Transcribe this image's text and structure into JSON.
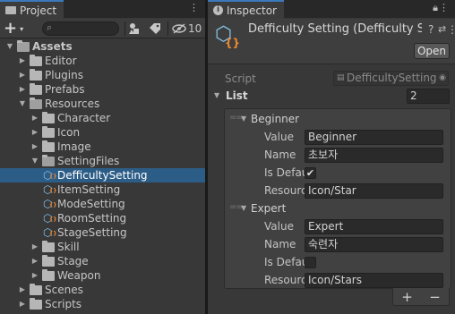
{
  "project": {
    "tab_label": "Project",
    "tab_menu": "⋮",
    "toolbar": {
      "add_label": "+",
      "add_caret": "▾",
      "hidden_count": "10"
    },
    "tree": [
      {
        "label": "Assets",
        "depth": 0,
        "arrow": "▼",
        "icon": "folder-open",
        "bold": true
      },
      {
        "label": "Editor",
        "depth": 1,
        "arrow": "▶",
        "icon": "folder"
      },
      {
        "label": "Plugins",
        "depth": 1,
        "arrow": "▶",
        "icon": "folder"
      },
      {
        "label": "Prefabs",
        "depth": 1,
        "arrow": "▶",
        "icon": "folder"
      },
      {
        "label": "Resources",
        "depth": 1,
        "arrow": "▼",
        "icon": "folder-open"
      },
      {
        "label": "Character",
        "depth": 2,
        "arrow": "▶",
        "icon": "folder"
      },
      {
        "label": "Icon",
        "depth": 2,
        "arrow": "▶",
        "icon": "folder"
      },
      {
        "label": "Image",
        "depth": 2,
        "arrow": "▶",
        "icon": "folder"
      },
      {
        "label": "SettingFiles",
        "depth": 2,
        "arrow": "▼",
        "icon": "folder-open"
      },
      {
        "label": "DefficultySetting",
        "depth": 3,
        "arrow": "",
        "icon": "so",
        "selected": true
      },
      {
        "label": "ItemSetting",
        "depth": 3,
        "arrow": "",
        "icon": "so"
      },
      {
        "label": "ModeSetting",
        "depth": 3,
        "arrow": "",
        "icon": "so"
      },
      {
        "label": "RoomSetting",
        "depth": 3,
        "arrow": "",
        "icon": "so"
      },
      {
        "label": "StageSetting",
        "depth": 3,
        "arrow": "",
        "icon": "so"
      },
      {
        "label": "Skill",
        "depth": 2,
        "arrow": "▶",
        "icon": "folder"
      },
      {
        "label": "Stage",
        "depth": 2,
        "arrow": "▶",
        "icon": "folder"
      },
      {
        "label": "Weapon",
        "depth": 2,
        "arrow": "▶",
        "icon": "folder"
      },
      {
        "label": "Scenes",
        "depth": 1,
        "arrow": "▶",
        "icon": "folder"
      },
      {
        "label": "Scripts",
        "depth": 1,
        "arrow": "▶",
        "icon": "folder"
      }
    ]
  },
  "inspector": {
    "tab_label": "Inspector",
    "tab_menu": "⋮",
    "title": "Defficulty Setting (Defficulty S",
    "open_label": "Open",
    "script_label": "Script",
    "script_value": "DefficultySetting",
    "list_label": "List",
    "list_size": "2",
    "field_labels": {
      "value": "Value",
      "name": "Name",
      "is_default": "Is Defau",
      "resource": "Resourc"
    },
    "items": [
      {
        "header": "Beginner",
        "value": "Beginner",
        "name": "초보자",
        "is_default": true,
        "resource": "Icon/Star"
      },
      {
        "header": "Expert",
        "value": "Expert",
        "name": "숙련자",
        "is_default": false,
        "resource": "Icon/Stars"
      }
    ],
    "add_label": "+",
    "remove_label": "−"
  }
}
